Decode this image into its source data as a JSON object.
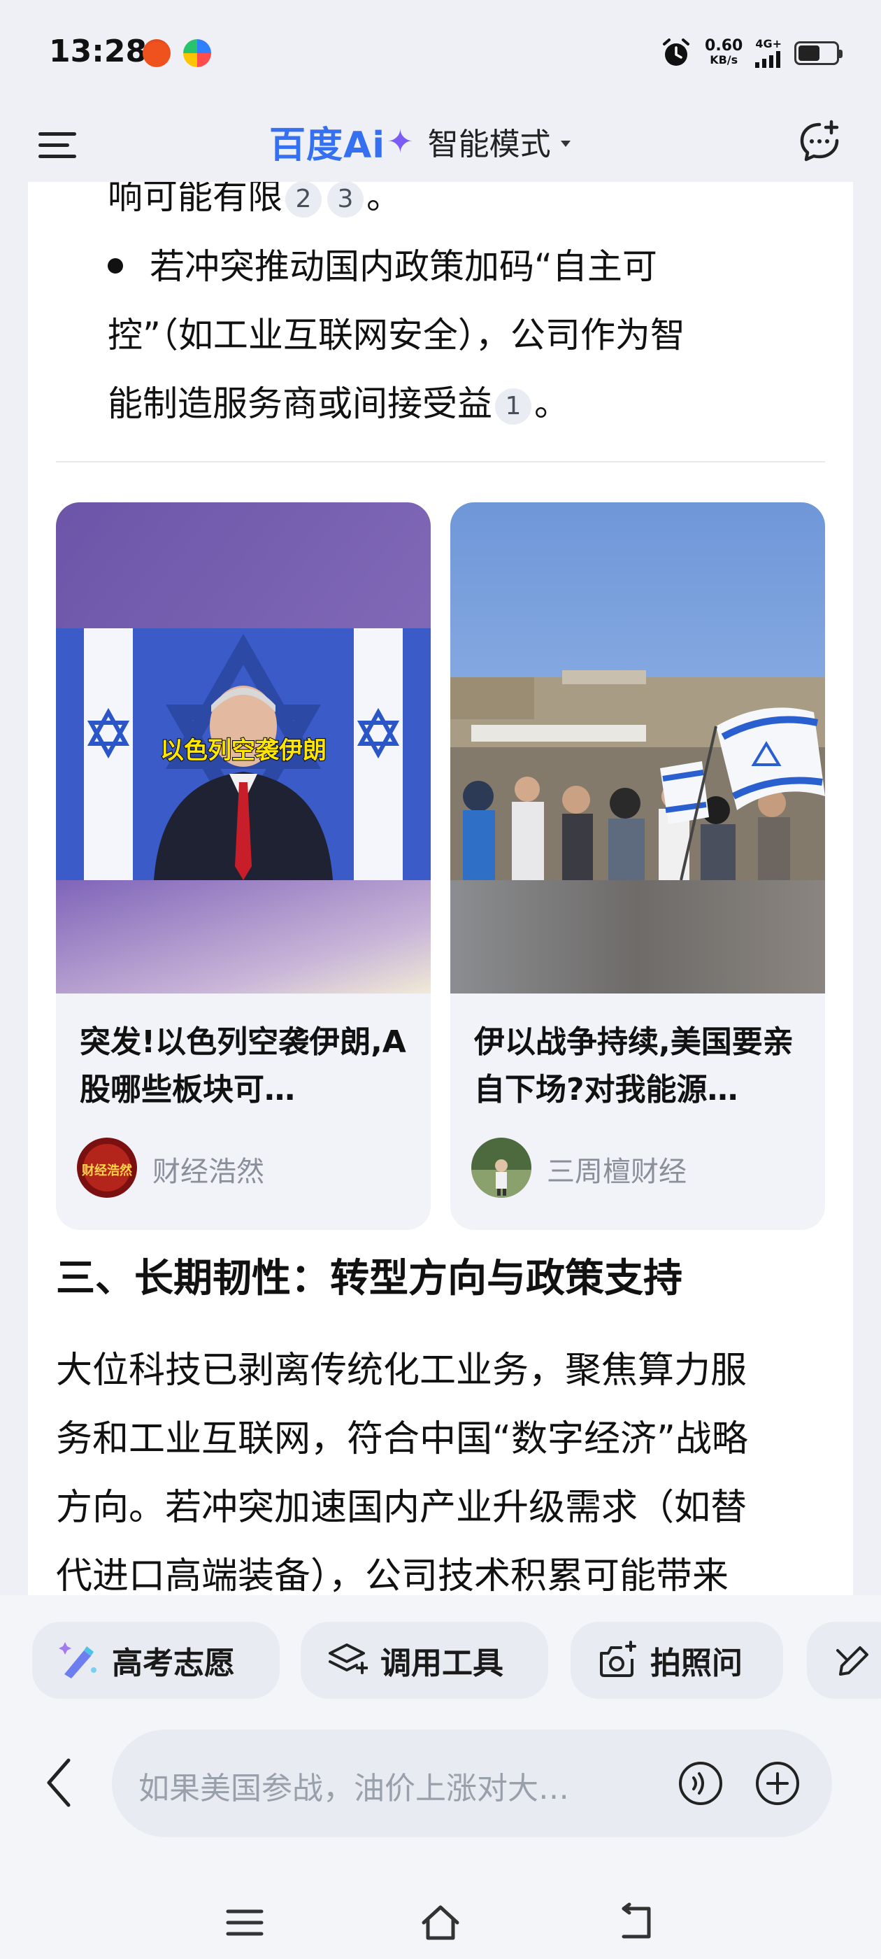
{
  "status_bar": {
    "time": "13:28",
    "net_speed": "0.60",
    "net_unit": "KB/s",
    "network": "4G+",
    "icons": [
      "app-icon-orange",
      "app-icon-colorful",
      "alarm-icon",
      "signal-icon",
      "battery-icon"
    ]
  },
  "header": {
    "logo_text": "百度Ai",
    "logo_star": "✦",
    "mode_label": "智能模式",
    "accent_color": "#3570f2",
    "star_color": "#7b5cf5"
  },
  "content": {
    "top_fragment": "响可能有限",
    "top_citations": [
      "2",
      "3"
    ],
    "top_end": "。",
    "bullet_line1": "若冲突推动国内政策加码“自主可",
    "bullet_line2": "控”（如工业互联网安全），公司作为智",
    "bullet_line3": "能制造服务商或间接受益",
    "bullet_citation": "1",
    "bullet_end": "。",
    "cards": [
      {
        "image_caption": "以色列空袭伊朗",
        "title": "突发!以色列空袭伊朗,A股哪些板块可…",
        "author": "财经浩然",
        "avatar_text": "财经浩然"
      },
      {
        "title": "伊以战争持续,美国要亲自下场?对我能源…",
        "author": "三周檀财经"
      }
    ],
    "section_title": "三、长期韧性：转型方向与政策支持",
    "body_lines": [
      "大位科技已剥离传统化工业务，聚焦算力服",
      "务和工业互联网，符合中国“数字经济”战略",
      "方向。若冲突加速国内产业升级需求（如替",
      "代进口高端装备），公司技术积累可能带来"
    ]
  },
  "chips": [
    "高考志愿",
    "调用工具",
    "拍照问"
  ],
  "input": {
    "placeholder": "如果美国参战，油价上涨对大…"
  }
}
